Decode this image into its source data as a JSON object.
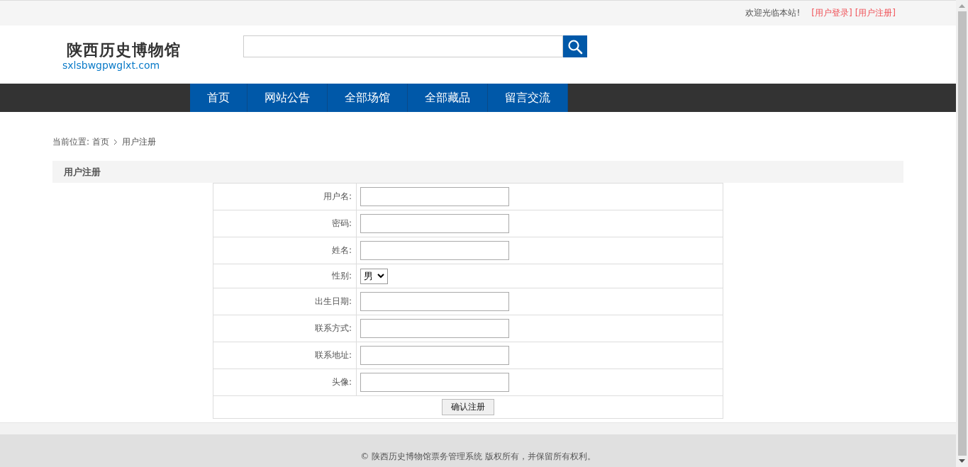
{
  "top_bar": {
    "welcome": "欢迎光临本站!",
    "links": [
      "[用户登录]",
      "[用户注册]"
    ]
  },
  "logo": {
    "title": "陕西历史博物馆",
    "domain": "sxlsbwgpwglxt.com"
  },
  "nav": [
    "首页",
    "网站公告",
    "全部场馆",
    "全部藏品",
    "留言交流"
  ],
  "breadcrumb": {
    "label": "当前位置:",
    "items": [
      "首页",
      "用户注册"
    ]
  },
  "form": {
    "title": "用户注册",
    "fields": [
      {
        "label": "用户名:",
        "kind": "input"
      },
      {
        "label": "密码:",
        "kind": "input"
      },
      {
        "label": "姓名:",
        "kind": "input"
      },
      {
        "label": "性别:",
        "kind": "select",
        "value": "男"
      },
      {
        "label": "出生日期:",
        "kind": "input"
      },
      {
        "label": "联系方式:",
        "kind": "input"
      },
      {
        "label": "联系地址:",
        "kind": "input"
      },
      {
        "label": "头像:",
        "kind": "input"
      }
    ],
    "submit": "确认注册"
  },
  "footer": "© 陕西历史博物馆票务管理系统 版权所有，并保留所有权利。"
}
